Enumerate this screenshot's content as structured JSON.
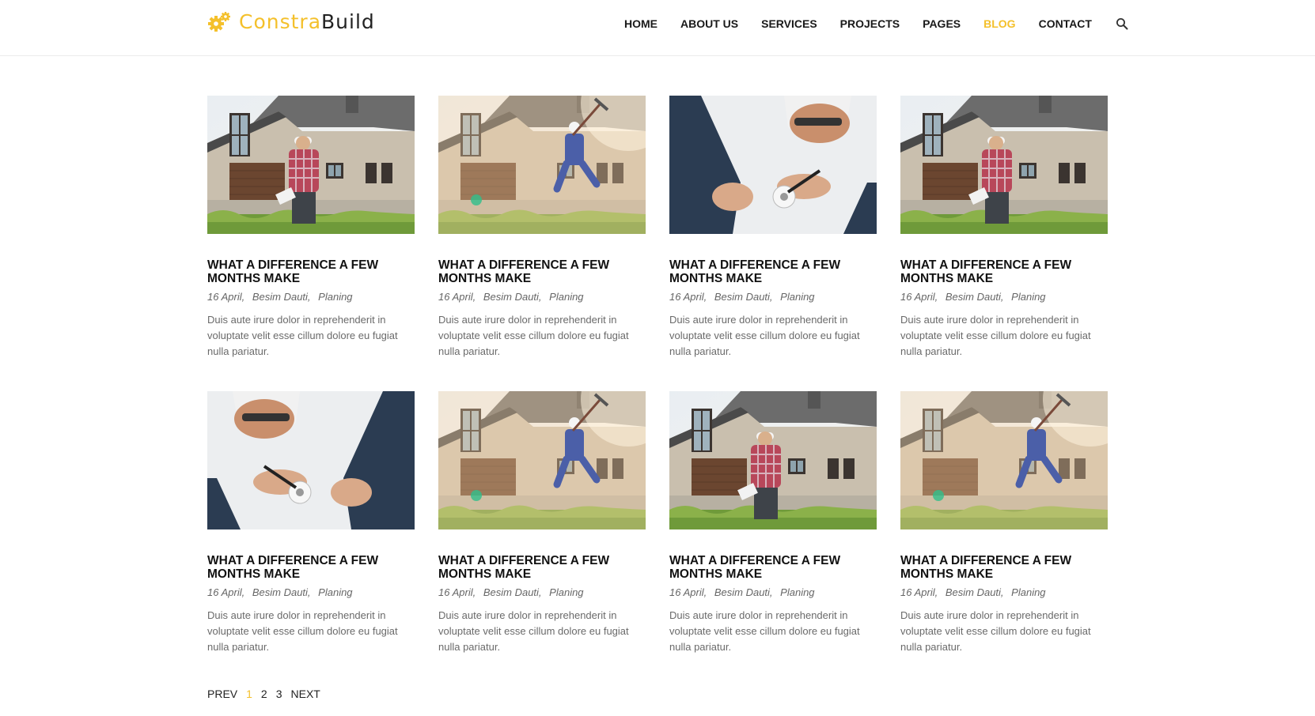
{
  "brand": {
    "name_part1": "Constra",
    "name_part2": "Build",
    "accent_color": "#f4c02b",
    "icon": "gears-icon"
  },
  "nav": {
    "items": [
      {
        "label": "HOME",
        "active": false
      },
      {
        "label": "ABOUT US",
        "active": false
      },
      {
        "label": "SERVICES",
        "active": false
      },
      {
        "label": "PROJECTS",
        "active": false
      },
      {
        "label": "PAGES",
        "active": false
      },
      {
        "label": "BLOG",
        "active": true
      },
      {
        "label": "CONTACT",
        "active": false
      }
    ],
    "search_icon": "search-icon"
  },
  "posts": [
    {
      "image": "worker-house",
      "title": "WHAT A DIFFERENCE A FEW MONTHS MAKE",
      "date": "16 April",
      "author": "Besim Dauti",
      "category": "Planing",
      "excerpt": "Duis aute irure dolor in reprehenderit in voluptate velit esse cillum dolore eu fugiat nulla pariatur."
    },
    {
      "image": "jumping-worker",
      "title": "WHAT A DIFFERENCE A FEW MONTHS MAKE",
      "date": "16 April",
      "author": "Besim Dauti",
      "category": "Planing",
      "excerpt": "Duis aute irure dolor in reprehenderit in voluptate velit esse cillum dolore eu fugiat nulla pariatur."
    },
    {
      "image": "electrician",
      "title": "WHAT A DIFFERENCE A FEW MONTHS MAKE",
      "date": "16 April",
      "author": "Besim Dauti",
      "category": "Planing",
      "excerpt": "Duis aute irure dolor in reprehenderit in voluptate velit esse cillum dolore eu fugiat nulla pariatur."
    },
    {
      "image": "worker-house",
      "title": "WHAT A DIFFERENCE A FEW MONTHS MAKE",
      "date": "16 April",
      "author": "Besim Dauti",
      "category": "Planing",
      "excerpt": "Duis aute irure dolor in reprehenderit in voluptate velit esse cillum dolore eu fugiat nulla pariatur."
    },
    {
      "image": "electrician",
      "title": "WHAT A DIFFERENCE A FEW MONTHS MAKE",
      "date": "16 April",
      "author": "Besim Dauti",
      "category": "Planing",
      "excerpt": "Duis aute irure dolor in reprehenderit in voluptate velit esse cillum dolore eu fugiat nulla pariatur."
    },
    {
      "image": "jumping-worker",
      "title": "WHAT A DIFFERENCE A FEW MONTHS MAKE",
      "date": "16 April",
      "author": "Besim Dauti",
      "category": "Planing",
      "excerpt": "Duis aute irure dolor in reprehenderit in voluptate velit esse cillum dolore eu fugiat nulla pariatur."
    },
    {
      "image": "worker-house",
      "title": "WHAT A DIFFERENCE A FEW MONTHS MAKE",
      "date": "16 April",
      "author": "Besim Dauti",
      "category": "Planing",
      "excerpt": "Duis aute irure dolor in reprehenderit in voluptate velit esse cillum dolore eu fugiat nulla pariatur."
    },
    {
      "image": "jumping-worker",
      "title": "WHAT A DIFFERENCE A FEW MONTHS MAKE",
      "date": "16 April",
      "author": "Besim Dauti",
      "category": "Planing",
      "excerpt": "Duis aute irure dolor in reprehenderit in voluptate velit esse cillum dolore eu fugiat nulla pariatur."
    }
  ],
  "pagination": {
    "prev": "PREV",
    "pages": [
      "1",
      "2",
      "3"
    ],
    "current": "1",
    "next": "NEXT"
  }
}
